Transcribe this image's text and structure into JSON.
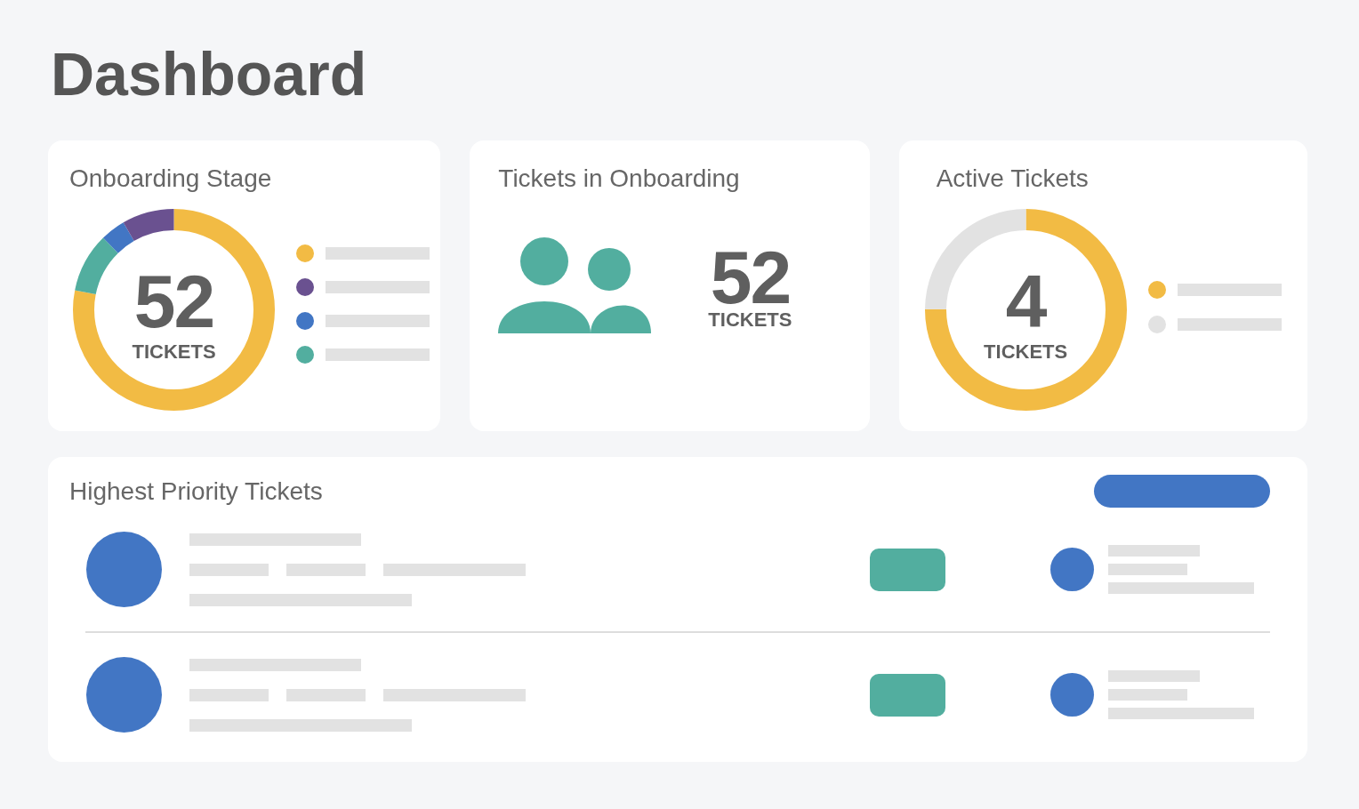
{
  "title": "Dashboard",
  "onboarding_stage": {
    "title": "Onboarding Stage",
    "value": "52",
    "unit": "TICKETS",
    "legend": [
      {
        "color": "#f2bb44"
      },
      {
        "color": "#6a5190"
      },
      {
        "color": "#4276c4"
      },
      {
        "color": "#52ae9f"
      }
    ]
  },
  "tickets_in_onboarding": {
    "title": "Tickets in Onboarding",
    "value": "52",
    "unit": "TICKETS"
  },
  "active_tickets": {
    "title": "Active Tickets",
    "value": "4",
    "unit": "TICKETS",
    "legend": [
      {
        "color": "#f2bb44"
      },
      {
        "color": "#e2e2e2"
      }
    ]
  },
  "highest_priority": {
    "title": "Highest Priority Tickets",
    "rows": [
      {
        "color": "#52ae9f"
      },
      {
        "color": "#52ae9f"
      }
    ]
  }
}
